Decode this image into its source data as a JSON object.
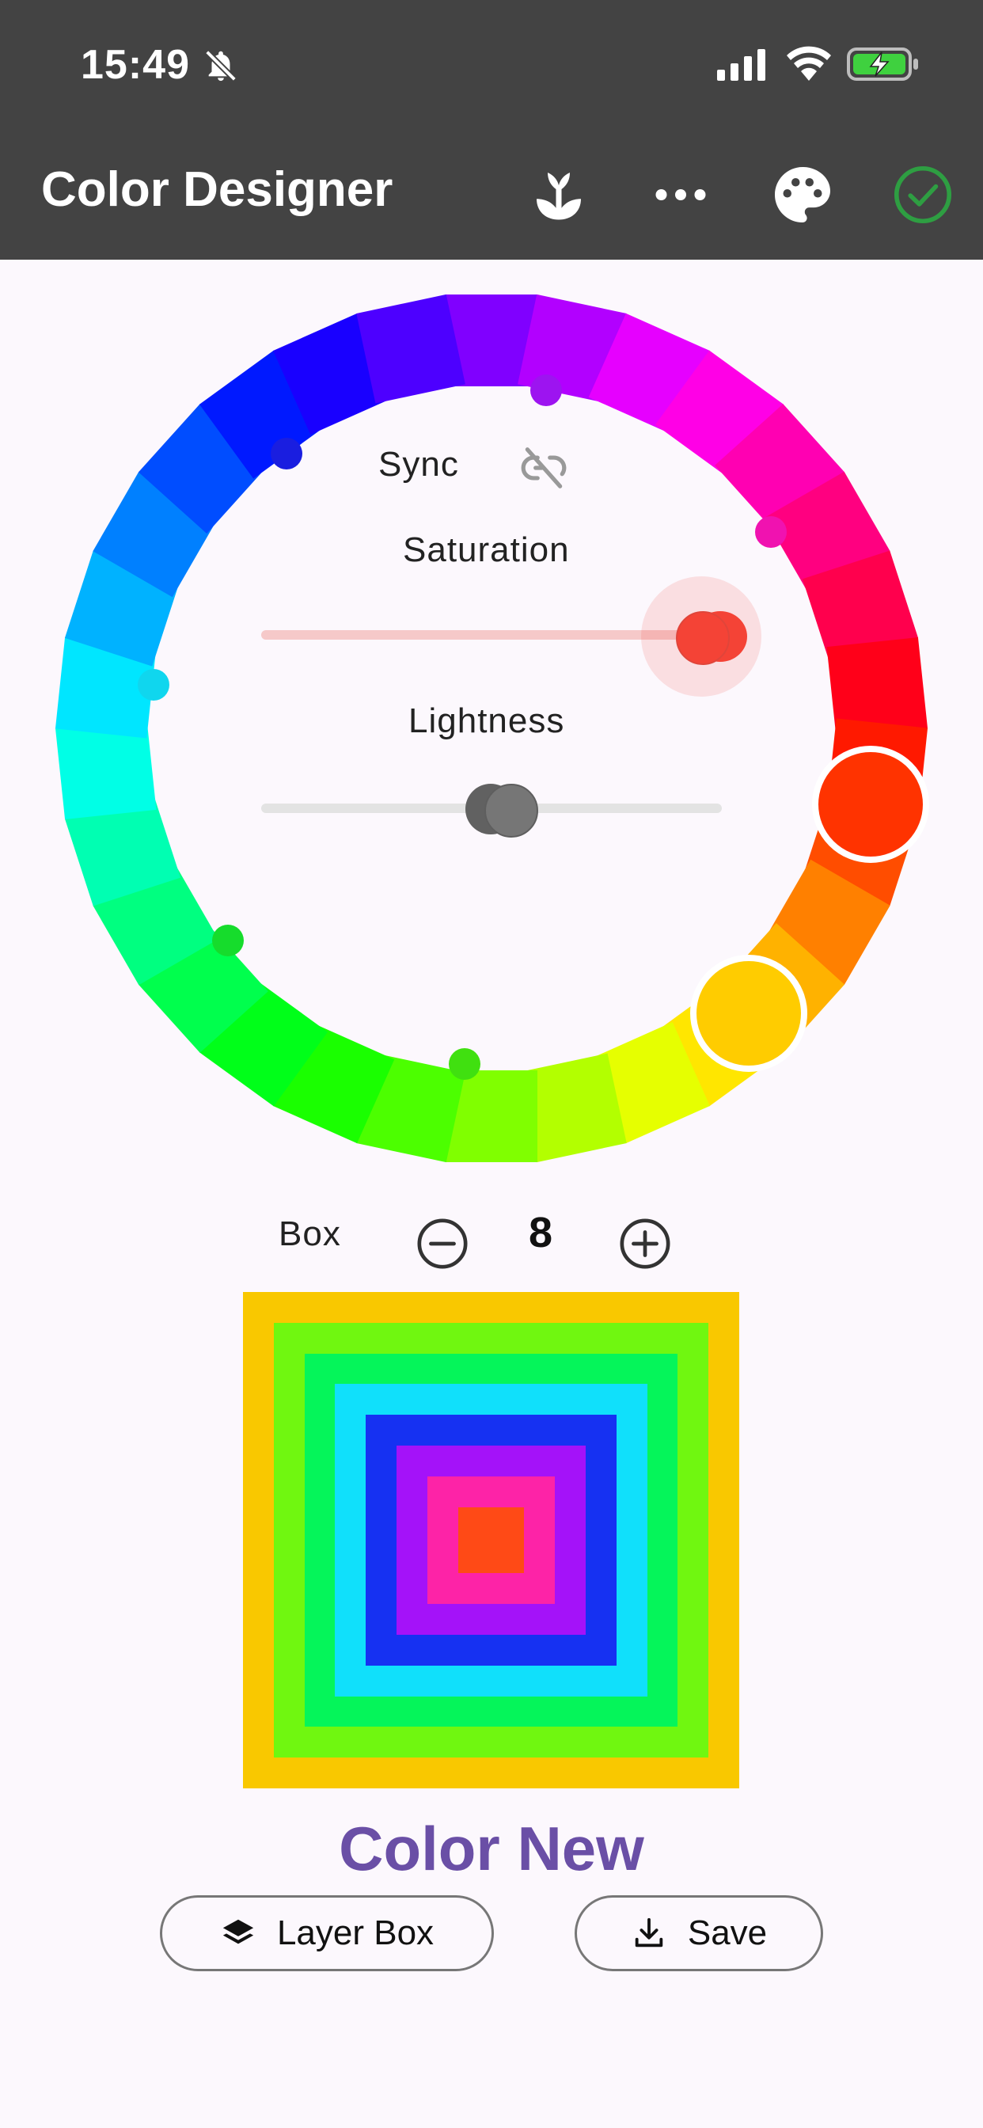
{
  "status": {
    "time": "15:49"
  },
  "appbar": {
    "title": "Color Designer"
  },
  "controls": {
    "sync_label": "Sync",
    "saturation_label": "Saturation",
    "lightness_label": "Lightness",
    "saturation_value": 0.95,
    "lightness_value": 0.5
  },
  "box": {
    "label": "Box",
    "count": "8"
  },
  "layers": [
    "#f9c800",
    "#70f710",
    "#05f55a",
    "#10e0fb",
    "#1631f2",
    "#a412f9",
    "#fd23a7",
    "#ff4a16"
  ],
  "color_name": "Color New",
  "buttons": {
    "layer_box": "Layer Box",
    "save": "Save"
  },
  "colors": {
    "accent": "#6a4fa6",
    "selected_primary": "#ff3300",
    "selected_secondary": "#ffcc00",
    "saturation_thumb": "#f44336",
    "check": "#2e9e42"
  }
}
